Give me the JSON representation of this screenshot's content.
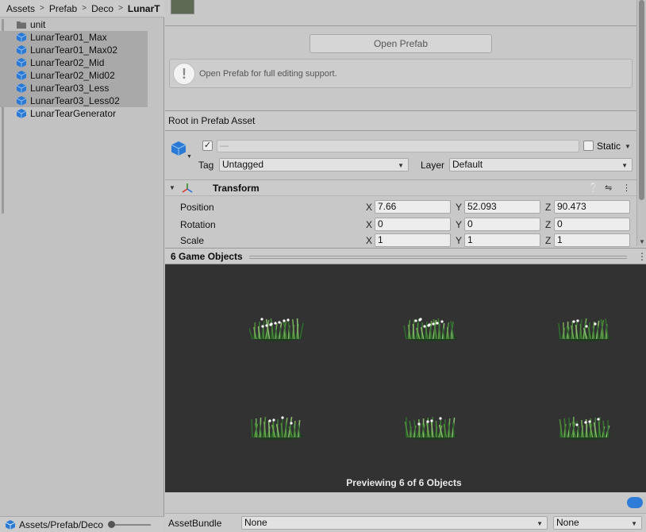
{
  "breadcrumb": [
    "Assets",
    "Prefab",
    "Deco",
    "LunarT"
  ],
  "files": [
    {
      "label": "unit",
      "icon": "folder-icon",
      "selected": false
    },
    {
      "label": "LunarTear01_Max",
      "icon": "prefab-cube-icon",
      "selected": true
    },
    {
      "label": "LunarTear01_Max02",
      "icon": "prefab-cube-icon",
      "selected": true
    },
    {
      "label": "LunarTear02_Mid",
      "icon": "prefab-cube-icon",
      "selected": true
    },
    {
      "label": "LunarTear02_Mid02",
      "icon": "prefab-cube-icon",
      "selected": true
    },
    {
      "label": "LunarTear03_Less",
      "icon": "prefab-cube-icon",
      "selected": true
    },
    {
      "label": "LunarTear03_Less02",
      "icon": "prefab-cube-icon",
      "selected": true
    },
    {
      "label": "LunarTearGenerator",
      "icon": "prefab-cube-icon",
      "selected": false
    }
  ],
  "left_footer": {
    "path": "Assets/Prefab/Deco"
  },
  "inspector": {
    "open_prefab_label": "Open Prefab",
    "help_text": "Open Prefab for full editing support.",
    "root_label": "Root in Prefab Asset",
    "name_placeholder": "—",
    "active_checked": "✓",
    "static_label": "Static",
    "tag_label": "Tag",
    "tag_value": "Untagged",
    "layer_label": "Layer",
    "layer_value": "Default"
  },
  "transform": {
    "title": "Transform",
    "rows": [
      {
        "label": "Position",
        "x": "7.66",
        "y": "52.093",
        "z": "90.473"
      },
      {
        "label": "Rotation",
        "x": "0",
        "y": "0",
        "z": "0"
      },
      {
        "label": "Scale",
        "x": "1",
        "y": "1",
        "z": "1"
      }
    ],
    "axis_labels": [
      "X",
      "Y",
      "Z"
    ]
  },
  "preview": {
    "title": "6 Game Objects",
    "caption": "Previewing 6 of 6 Objects",
    "items": 6,
    "bg_color": "#323232"
  },
  "asset_bundle": {
    "label": "AssetBundle",
    "bundle_value": "None",
    "variant_value": "None"
  },
  "colors": {
    "prefab_blue": "#2a7ad5",
    "selection": "#a9a9a9"
  }
}
